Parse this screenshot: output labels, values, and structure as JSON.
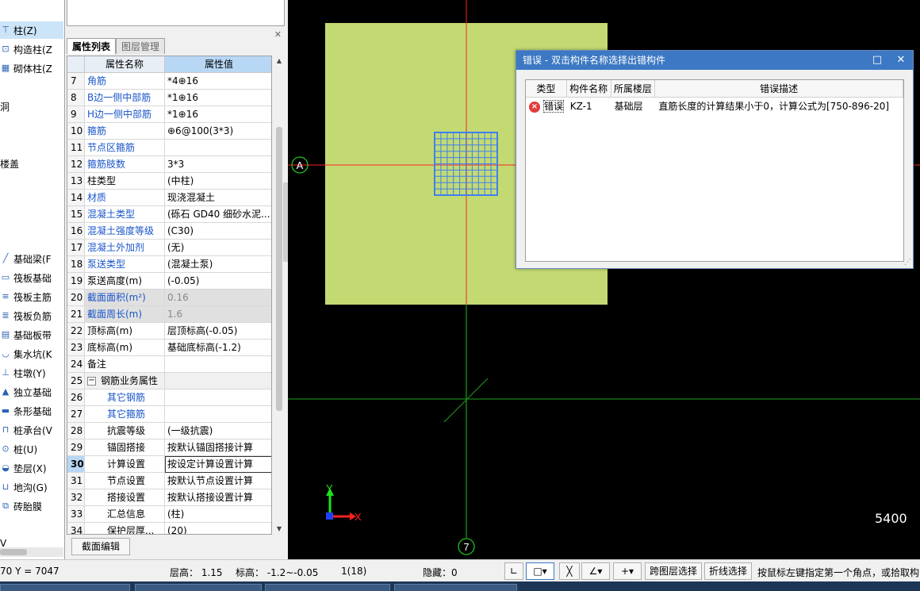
{
  "left_tree": {
    "items": [
      {
        "label": "柱(Z)",
        "icon": "column-icon",
        "selected": true
      },
      {
        "label": "构造柱(Z",
        "icon": "constructional-column-icon"
      },
      {
        "label": "砌体柱(Z",
        "icon": "masonry-column-icon"
      },
      {
        "label": "洞",
        "icon": ""
      },
      {
        "label": "楼盖",
        "icon": ""
      },
      {
        "label": "基础梁(F",
        "icon": "foundation-beam-icon"
      },
      {
        "label": "筏板基础",
        "icon": "raft-foundation-icon"
      },
      {
        "label": "筏板主筋",
        "icon": "raft-main-rebar-icon"
      },
      {
        "label": "筏板负筋",
        "icon": "raft-negative-rebar-icon"
      },
      {
        "label": "基础板带",
        "icon": "foundation-strip-icon"
      },
      {
        "label": "集水坑(K",
        "icon": "sump-pit-icon"
      },
      {
        "label": "柱墩(Y)",
        "icon": "column-pier-icon"
      },
      {
        "label": "独立基础",
        "icon": "isolated-footing-icon"
      },
      {
        "label": "条形基础",
        "icon": "strip-footing-icon"
      },
      {
        "label": "桩承台(V",
        "icon": "pile-cap-icon"
      },
      {
        "label": "桩(U)",
        "icon": "pile-icon"
      },
      {
        "label": "垫层(X)",
        "icon": "cushion-layer-icon"
      },
      {
        "label": "地沟(G)",
        "icon": "trench-icon"
      },
      {
        "label": "砖胎膜",
        "icon": "brick-mold-icon"
      },
      {
        "label": "V",
        "icon": ""
      }
    ]
  },
  "props": {
    "tabs": [
      "属性列表",
      "图层管理"
    ],
    "header": {
      "name": "属性名称",
      "value": "属性值"
    },
    "rows": [
      {
        "num": "7",
        "name": "角筋",
        "value": "*4⊕16",
        "style": "blue"
      },
      {
        "num": "8",
        "name": "B边一侧中部筋",
        "value": "*1⊕16",
        "style": "blue"
      },
      {
        "num": "9",
        "name": "H边一侧中部筋",
        "value": "*1⊕16",
        "style": "blue"
      },
      {
        "num": "10",
        "name": "箍筋",
        "value": "⊕6@100(3*3)",
        "style": "blue"
      },
      {
        "num": "11",
        "name": "节点区箍筋",
        "value": "",
        "style": "blue"
      },
      {
        "num": "12",
        "name": "箍筋肢数",
        "value": "3*3",
        "style": "blue"
      },
      {
        "num": "13",
        "name": "柱类型",
        "value": "(中柱)",
        "style": ""
      },
      {
        "num": "14",
        "name": "材质",
        "value": "现浇混凝土",
        "style": "blue"
      },
      {
        "num": "15",
        "name": "混凝土类型",
        "value": "(砾石 GD40 细砂水泥...",
        "style": "blue"
      },
      {
        "num": "16",
        "name": "混凝土强度等级",
        "value": "(C30)",
        "style": "blue"
      },
      {
        "num": "17",
        "name": "混凝土外加剂",
        "value": "(无)",
        "style": "blue"
      },
      {
        "num": "18",
        "name": "泵送类型",
        "value": "(混凝土泵)",
        "style": "blue"
      },
      {
        "num": "19",
        "name": "泵送高度(m)",
        "value": "(-0.05)",
        "style": ""
      },
      {
        "num": "20",
        "name": "截面面积(m²)",
        "value": "0.16",
        "style": "blue grey"
      },
      {
        "num": "21",
        "name": "截面周长(m)",
        "value": "1.6",
        "style": "blue grey"
      },
      {
        "num": "22",
        "name": "顶标高(m)",
        "value": "层顶标高(-0.05)",
        "style": ""
      },
      {
        "num": "23",
        "name": "底标高(m)",
        "value": "基础底标高(-1.2)",
        "style": ""
      },
      {
        "num": "24",
        "name": "备注",
        "value": "",
        "style": ""
      },
      {
        "num": "25",
        "name": "钢筋业务属性",
        "value": "",
        "style": "group"
      },
      {
        "num": "26",
        "name": "其它钢筋",
        "value": "",
        "style": "blue sub"
      },
      {
        "num": "27",
        "name": "其它箍筋",
        "value": "",
        "style": "blue sub"
      },
      {
        "num": "28",
        "name": "抗震等级",
        "value": "(一级抗震)",
        "style": "sub"
      },
      {
        "num": "29",
        "name": "锚固搭接",
        "value": "按默认锚固搭接计算",
        "style": "sub"
      },
      {
        "num": "30",
        "name": "计算设置",
        "value": "按设定计算设置计算",
        "style": "sub sel"
      },
      {
        "num": "31",
        "name": "节点设置",
        "value": "按默认节点设置计算",
        "style": "sub"
      },
      {
        "num": "32",
        "name": "搭接设置",
        "value": "按默认搭接设置计算",
        "style": "sub"
      },
      {
        "num": "33",
        "name": "汇总信息",
        "value": "(柱)",
        "style": "sub"
      },
      {
        "num": "34",
        "name": "保护层厚...",
        "value": "(20)",
        "style": "sub"
      }
    ],
    "section_edit_button": "截面编辑"
  },
  "canvas": {
    "axis_a_label": "A",
    "axis_7_label": "7",
    "x_axis_label": "X",
    "y_axis_label": "Y",
    "scale_text": "5400",
    "colors": {
      "background": "#000000",
      "slab": "#c3da73",
      "column_grid": "#3f7ff0",
      "axis_red": "#ff2020",
      "axis_green": "#20c020"
    }
  },
  "error_dialog": {
    "title": "错误 - 双击构件名称选择出错构件",
    "columns": [
      "类型",
      "构件名称",
      "所属楼层",
      "错误描述"
    ],
    "rows": [
      {
        "type": "错误",
        "name": "KZ-1",
        "floor": "基础层",
        "desc": "直筋长度的计算结果小于0，计算公式为[750-896-20]"
      }
    ]
  },
  "statusbar": {
    "coords": "70 Y = 7047",
    "floor_height": "层高： 1.15",
    "elevation": "标高： -1.2~-0.05",
    "count": "1(18)",
    "hidden": "隐藏：0",
    "cross_layer_select": "跨图层选择",
    "polyline_select": "折线选择",
    "tip": "按鼠标左键指定第一个角点，或拾取构"
  }
}
